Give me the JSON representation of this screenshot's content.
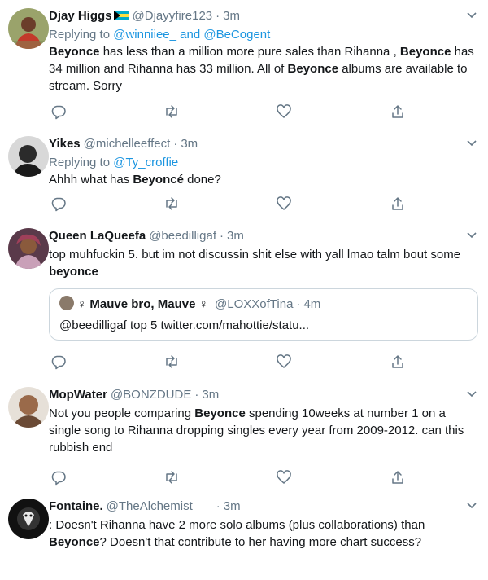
{
  "tweets": [
    {
      "name": "Djay Higgs",
      "handle": "@Djayyfire123",
      "time": "3m",
      "reply_prefix": "Replying to",
      "reply_to": "@winniiee_ and @BeCogent",
      "text_segments": [
        {
          "t": "Beyonce",
          "b": true
        },
        {
          "t": " has less than a million more pure sales than Rihanna , ",
          "b": false
        },
        {
          "t": "Beyonce",
          "b": true
        },
        {
          "t": " has 34 million and Rihanna has 33 million. All of ",
          "b": false
        },
        {
          "t": "Beyonce",
          "b": true
        },
        {
          "t": " albums are available to stream. Sorry",
          "b": false
        }
      ]
    },
    {
      "name": "Yikes",
      "handle": "@michelleeffect",
      "time": "3m",
      "reply_prefix": "Replying to",
      "reply_to": "@Ty_croffie",
      "text_segments": [
        {
          "t": "Ahhh what has ",
          "b": false
        },
        {
          "t": "Beyoncé",
          "b": true
        },
        {
          "t": " done?",
          "b": false
        }
      ]
    },
    {
      "name": "Queen LaQueefa",
      "handle": "@beedilligaf",
      "time": "3m",
      "text_segments": [
        {
          "t": "top muhfuckin 5. but im not discussin shit else with yall lmao talm bout some ",
          "b": false
        },
        {
          "t": "beyonce",
          "b": true
        }
      ],
      "quote": {
        "name": "♀ Mauve bro, Mauve ♀",
        "handle": "@LOXXofTina",
        "time": "4m",
        "text": "@beedilligaf top 5 twitter.com/mahottie/statu..."
      }
    },
    {
      "name": "MopWater",
      "handle": "@BONZDUDE",
      "time": "3m",
      "text_segments": [
        {
          "t": "Not you people comparing ",
          "b": false
        },
        {
          "t": "Beyonce",
          "b": true
        },
        {
          "t": " spending 10weeks at number 1 on a single song to Rihanna dropping singles every year from 2009-2012. can this rubbish end",
          "b": false
        }
      ]
    },
    {
      "name": "Fontaine.",
      "handle": "@TheAlchemist___",
      "time": "3m",
      "text_segments": [
        {
          "t": ": Doesn't Rihanna have 2 more solo albums (plus collaborations) than ",
          "b": false
        },
        {
          "t": "Beyonce",
          "b": true
        },
        {
          "t": "? Doesn't that contribute to her having more chart success?",
          "b": false
        }
      ]
    }
  ],
  "icons": {
    "reply": "reply-icon",
    "retweet": "retweet-icon",
    "like": "like-icon",
    "share": "share-icon",
    "caret": "chevron-down-icon",
    "flag": "bahamas-flag-icon"
  },
  "colors": {
    "accent": "#1b95e0",
    "muted": "#657786",
    "text": "#14171a",
    "divider": "#e6ecf0"
  }
}
